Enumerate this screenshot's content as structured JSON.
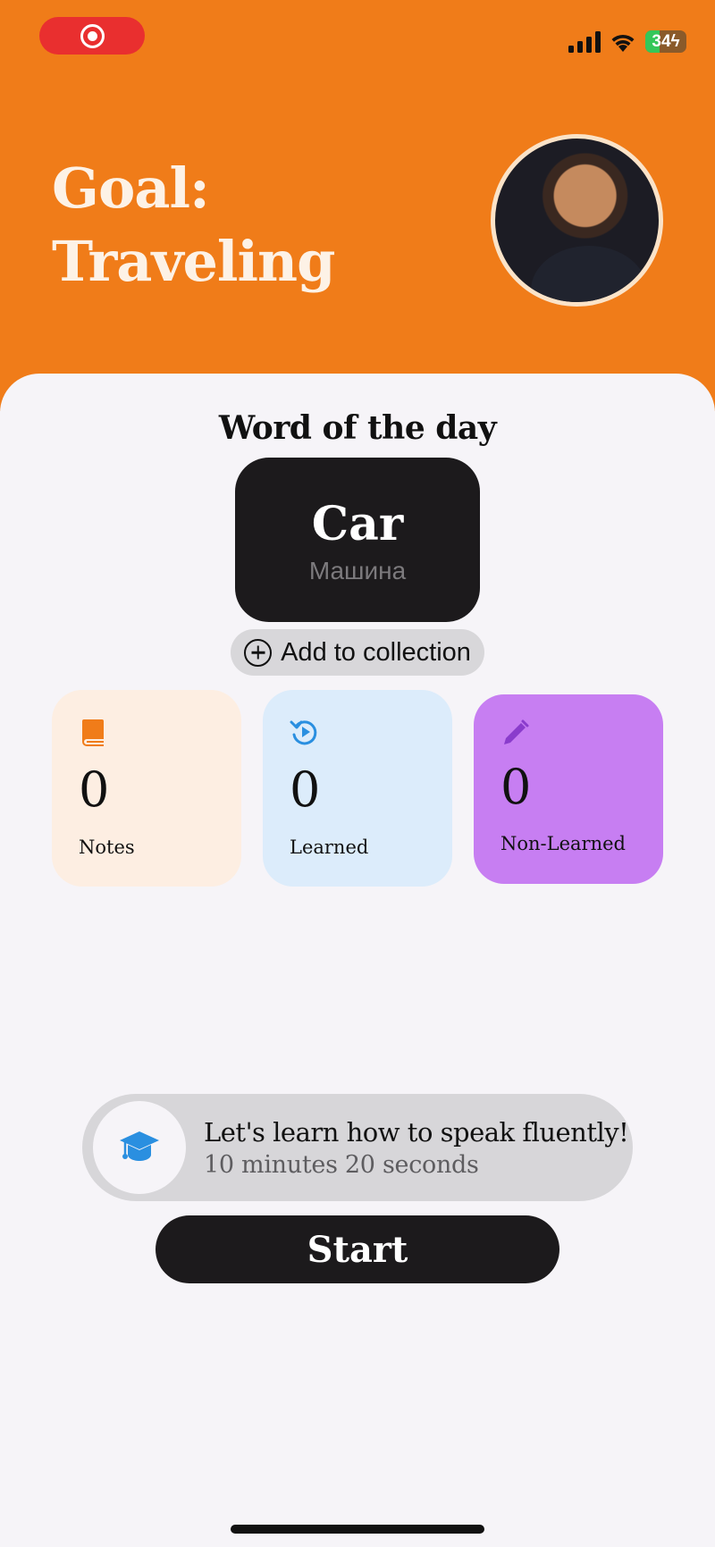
{
  "status_bar": {
    "recording_icon": "screen-recording-icon",
    "signal_icon": "cellular-signal-icon",
    "wifi_icon": "wifi-icon",
    "battery_text": "34",
    "battery_level_percent": 34,
    "charging_icon": "charging-bolt-icon"
  },
  "header": {
    "goal_line1": "Goal:",
    "goal_line2": "Traveling",
    "background_color": "#f07c19"
  },
  "word_of_day": {
    "heading": "Word of the day",
    "word": "Car",
    "translation": "Машина",
    "add_label": "Add to collection",
    "add_icon": "plus-circle-icon"
  },
  "stats": [
    {
      "icon": "book-icon",
      "value": "0",
      "label": "Notes",
      "color": "#fdeee2",
      "icon_color": "#f07c19"
    },
    {
      "icon": "replay-icon",
      "value": "0",
      "label": "Learned",
      "color": "#dcecfb",
      "icon_color": "#2a8fe0"
    },
    {
      "icon": "pencil-icon",
      "value": "0",
      "label": "Non-Learned",
      "color": "#c77ef2",
      "icon_color": "#8a3ccc"
    }
  ],
  "lesson": {
    "icon": "graduation-cap-icon",
    "title": "Let's learn how to speak fluently!",
    "duration": "10 minutes 20 seconds"
  },
  "start_label": "Start"
}
